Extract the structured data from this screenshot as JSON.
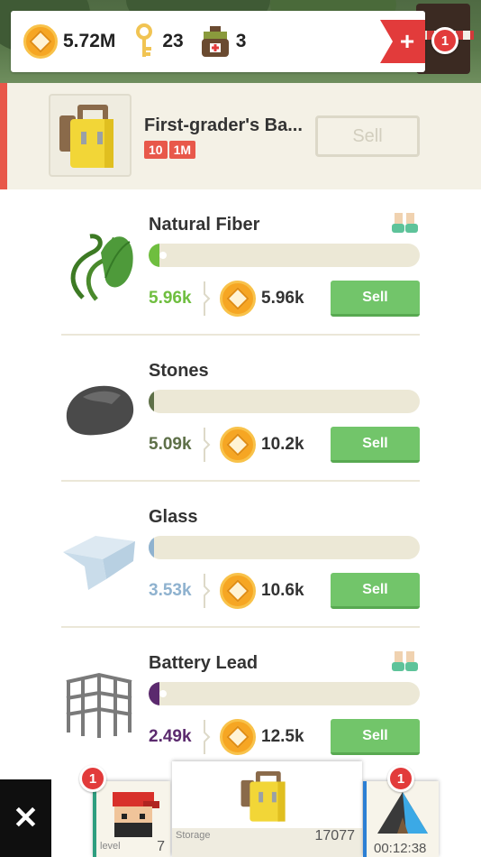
{
  "resources_bar": {
    "coins": "5.72M",
    "keys": "23",
    "first_aid_kits": "3",
    "notification_count": "1",
    "icons": [
      "coin-icon",
      "key-icon",
      "first-aid-kit-icon",
      "plus-icon"
    ]
  },
  "equipped_item": {
    "name": "First-grader's Ba...",
    "tags": [
      "10",
      "1M"
    ],
    "sell_label": "Sell",
    "icon": "backpack-icon"
  },
  "items": [
    {
      "name": "Natural Fiber",
      "count": "5.96k",
      "price": "5.96k",
      "sell_label": "Sell",
      "icon": "natural-fiber-icon",
      "color": "#6fbe3f",
      "has_worker": true,
      "fill_fraction": 0.05
    },
    {
      "name": "Stones",
      "count": "5.09k",
      "price": "10.2k",
      "sell_label": "Sell",
      "icon": "stones-icon",
      "color": "#5e7048",
      "has_worker": false,
      "fill_fraction": 0.02
    },
    {
      "name": "Glass",
      "count": "3.53k",
      "price": "10.6k",
      "sell_label": "Sell",
      "icon": "glass-icon",
      "color": "#8fb2cf",
      "has_worker": false,
      "fill_fraction": 0.02
    },
    {
      "name": "Battery Lead",
      "count": "2.49k",
      "price": "12.5k",
      "sell_label": "Sell",
      "icon": "battery-lead-icon",
      "color": "#5b2a6e",
      "has_worker": true,
      "fill_fraction": 0.05
    }
  ],
  "dock": {
    "level_badge": "1",
    "level_label": "level",
    "level_value": "7",
    "storage_label": "Storage",
    "storage_value": "17077",
    "timer_badge": "1",
    "timer": "00:12:38",
    "close_icon": "close-icon"
  }
}
